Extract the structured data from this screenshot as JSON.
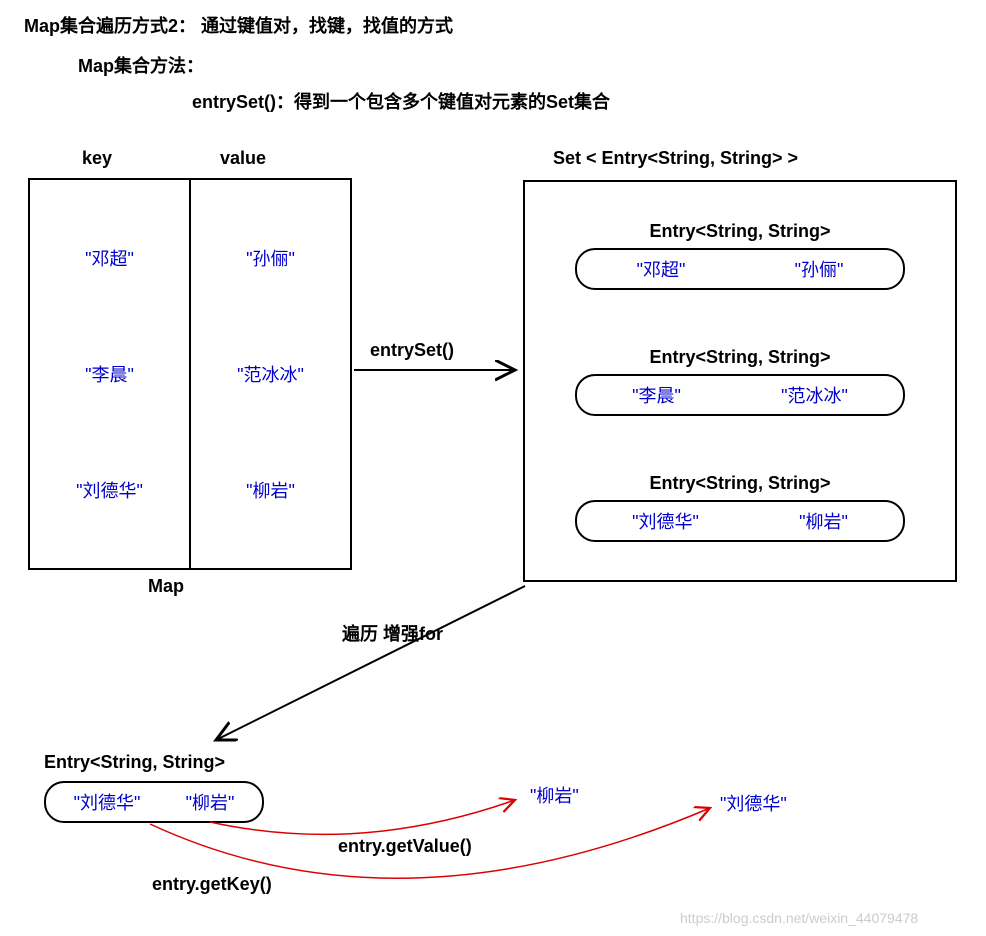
{
  "title": {
    "line1": "Map集合遍历方式2：  通过键值对，找键，找值的方式",
    "line2": "Map集合方法：",
    "line3": "entrySet()：得到一个包含多个键值对元素的Set集合"
  },
  "map": {
    "label": "Map",
    "key_header": "key",
    "value_header": "value",
    "entries": [
      {
        "key": "\"邓超\"",
        "value": "\"孙俪\""
      },
      {
        "key": "\"李晨\"",
        "value": "\"范冰冰\""
      },
      {
        "key": "\"刘德华\"",
        "value": "\"柳岩\""
      }
    ]
  },
  "arrow_label": "entrySet()",
  "set": {
    "header": "Set <   Entry<String,  String>   >",
    "entry_type": "Entry<String,  String>",
    "entries": [
      {
        "key": "\"邓超\"",
        "value": "\"孙俪\""
      },
      {
        "key": "\"李晨\"",
        "value": "\"范冰冰\""
      },
      {
        "key": "\"刘德华\"",
        "value": "\"柳岩\""
      }
    ]
  },
  "iterate_label": "遍历   增强for",
  "bottom": {
    "entry_type": "Entry<String,  String>",
    "entry": {
      "key": "\"刘德华\"",
      "value": "\"柳岩\""
    },
    "get_key_label": "entry.getKey()",
    "get_value_label": "entry.getValue()",
    "value_result": "\"柳岩\"",
    "key_result": "\"刘德华\""
  },
  "watermark": "https://blog.csdn.net/weixin_44079478"
}
